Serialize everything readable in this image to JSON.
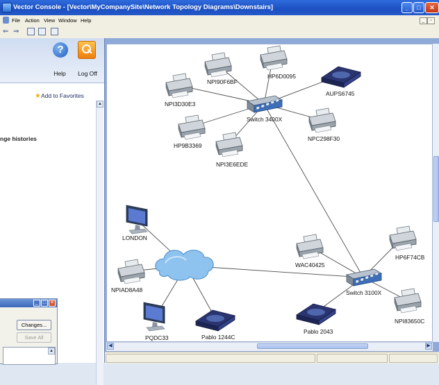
{
  "app": {
    "title": "Vector Console - [Vector\\MyCompanySite\\Network Topology Diagrams\\Downstairs]"
  },
  "menu": [
    "File",
    "Action",
    "View",
    "Window",
    "Help"
  ],
  "left_panel": {
    "help_label": "Help",
    "logoff_label": "Log Off",
    "favorites_label": "Add to Favorites",
    "section_text": "nge histories"
  },
  "mini_dialog": {
    "changes_label": "Changes...",
    "saveall_label": "Save All"
  },
  "diagram": {
    "devices": [
      {
        "id": "npi90f6bf",
        "label": "NPI90F6BF",
        "kind": "printer"
      },
      {
        "id": "hp6d0095",
        "label": "HP6D0095",
        "kind": "printer"
      },
      {
        "id": "aups6745",
        "label": "AUPS6745",
        "kind": "ups"
      },
      {
        "id": "npi3d30e3",
        "label": "NPI3D30E3",
        "kind": "printer"
      },
      {
        "id": "switch3400x",
        "label": "Switch 3400X",
        "kind": "switch"
      },
      {
        "id": "npc298f30",
        "label": "NPC298F30",
        "kind": "printer"
      },
      {
        "id": "hp9b3369",
        "label": "HP9B3369",
        "kind": "printer"
      },
      {
        "id": "npi3e6ede",
        "label": "NPI3E6EDE",
        "kind": "printer"
      },
      {
        "id": "london",
        "label": "LONDON",
        "kind": "monitor"
      },
      {
        "id": "cloud",
        "label": "",
        "kind": "cloud"
      },
      {
        "id": "npiad8a48",
        "label": "NPIAD8A48",
        "kind": "printer"
      },
      {
        "id": "pqdc33",
        "label": "PQDC33",
        "kind": "monitor"
      },
      {
        "id": "pablo1244c",
        "label": "Pablo 1244C",
        "kind": "ups"
      },
      {
        "id": "wac40425",
        "label": "WAC40425",
        "kind": "printer"
      },
      {
        "id": "switch3100x",
        "label": "Switch 3100X",
        "kind": "switch"
      },
      {
        "id": "hp6f74cb",
        "label": "HP6F74CB",
        "kind": "printer"
      },
      {
        "id": "pablo2043",
        "label": "Pablo 2043",
        "kind": "ups"
      },
      {
        "id": "npi83650c",
        "label": "NPI83650C",
        "kind": "printer"
      }
    ],
    "links": [
      [
        "switch3400x",
        "npi90f6bf"
      ],
      [
        "switch3400x",
        "hp6d0095"
      ],
      [
        "switch3400x",
        "aups6745"
      ],
      [
        "switch3400x",
        "npi3d30e3"
      ],
      [
        "switch3400x",
        "npc298f30"
      ],
      [
        "switch3400x",
        "hp9b3369"
      ],
      [
        "switch3400x",
        "npi3e6ede"
      ],
      [
        "switch3400x",
        "switch3100x"
      ],
      [
        "cloud",
        "london"
      ],
      [
        "cloud",
        "npiad8a48"
      ],
      [
        "cloud",
        "pqdc33"
      ],
      [
        "cloud",
        "pablo1244c"
      ],
      [
        "cloud",
        "switch3100x"
      ],
      [
        "switch3100x",
        "wac40425"
      ],
      [
        "switch3100x",
        "hp6f74cb"
      ],
      [
        "switch3100x",
        "pablo2043"
      ],
      [
        "switch3100x",
        "npi83650c"
      ]
    ]
  }
}
